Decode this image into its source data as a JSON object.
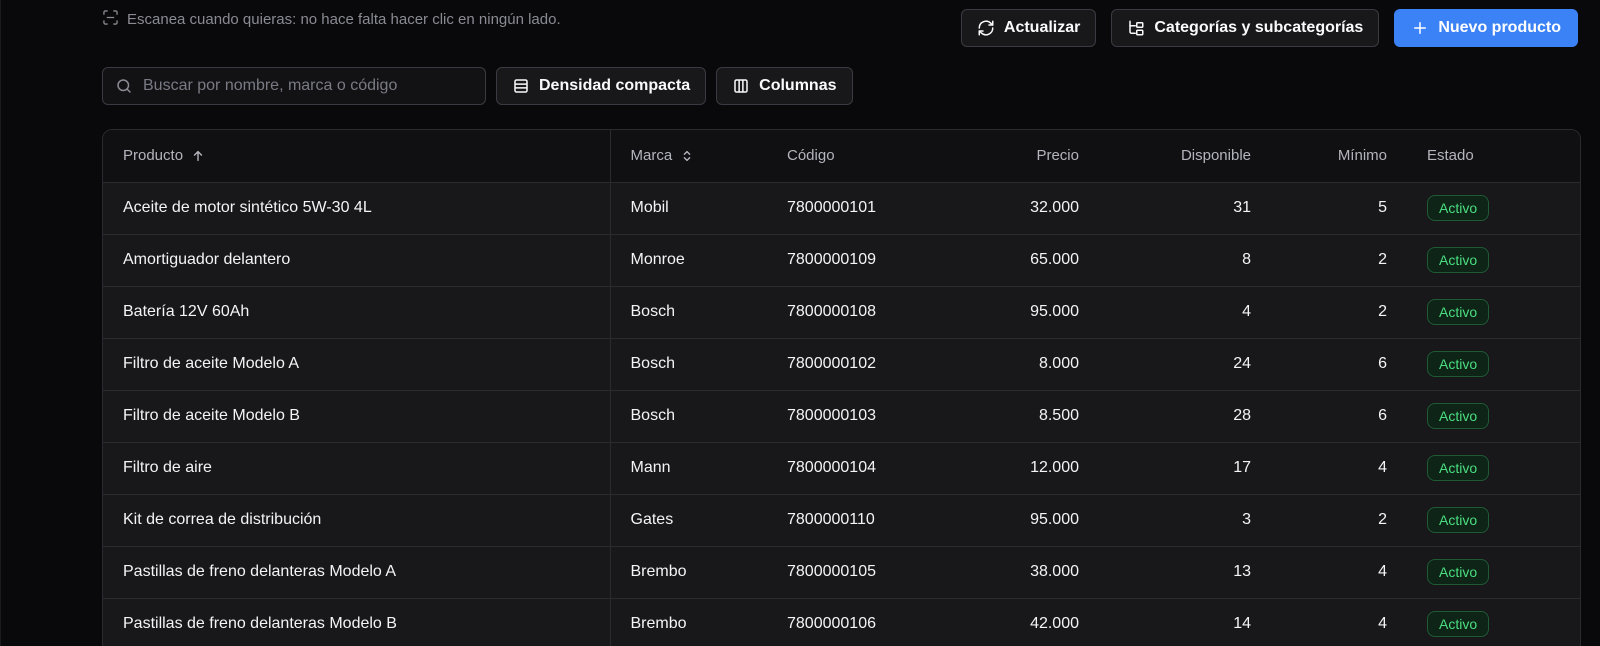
{
  "hint": {
    "text": "Escanea cuando quieras: no hace falta hacer clic en ningún lado.",
    "icon": "scan-icon"
  },
  "actions": {
    "refresh_label": "Actualizar",
    "categories_label": "Categorías y subcategorías",
    "new_product_label": "Nuevo producto"
  },
  "toolbar": {
    "search_placeholder": "Buscar por nombre, marca o código",
    "search_value": "",
    "density_label": "Densidad compacta",
    "columns_label": "Columnas"
  },
  "table": {
    "columns": {
      "product": "Producto",
      "brand": "Marca",
      "code": "Código",
      "price": "Precio",
      "available": "Disponible",
      "minimum": "Mínimo",
      "status": "Estado"
    },
    "rows": [
      {
        "product": "Aceite de motor sintético 5W-30 4L",
        "brand": "Mobil",
        "code": "7800000101",
        "price": "32.000",
        "available": "31",
        "minimum": "5",
        "status": "Activo"
      },
      {
        "product": "Amortiguador delantero",
        "brand": "Monroe",
        "code": "7800000109",
        "price": "65.000",
        "available": "8",
        "minimum": "2",
        "status": "Activo"
      },
      {
        "product": "Batería 12V 60Ah",
        "brand": "Bosch",
        "code": "7800000108",
        "price": "95.000",
        "available": "4",
        "minimum": "2",
        "status": "Activo"
      },
      {
        "product": "Filtro de aceite Modelo A",
        "brand": "Bosch",
        "code": "7800000102",
        "price": "8.000",
        "available": "24",
        "minimum": "6",
        "status": "Activo"
      },
      {
        "product": "Filtro de aceite Modelo B",
        "brand": "Bosch",
        "code": "7800000103",
        "price": "8.500",
        "available": "28",
        "minimum": "6",
        "status": "Activo"
      },
      {
        "product": "Filtro de aire",
        "brand": "Mann",
        "code": "7800000104",
        "price": "12.000",
        "available": "17",
        "minimum": "4",
        "status": "Activo"
      },
      {
        "product": "Kit de correa de distribución",
        "brand": "Gates",
        "code": "7800000110",
        "price": "95.000",
        "available": "3",
        "minimum": "2",
        "status": "Activo"
      },
      {
        "product": "Pastillas de freno delanteras Modelo A",
        "brand": "Brembo",
        "code": "7800000105",
        "price": "38.000",
        "available": "13",
        "minimum": "4",
        "status": "Activo"
      },
      {
        "product": "Pastillas de freno delanteras Modelo B",
        "brand": "Brembo",
        "code": "7800000106",
        "price": "42.000",
        "available": "14",
        "minimum": "4",
        "status": "Activo"
      }
    ]
  },
  "colors": {
    "background": "#09090b",
    "primary": "#3b82f6",
    "status_active": "#4ade80"
  }
}
